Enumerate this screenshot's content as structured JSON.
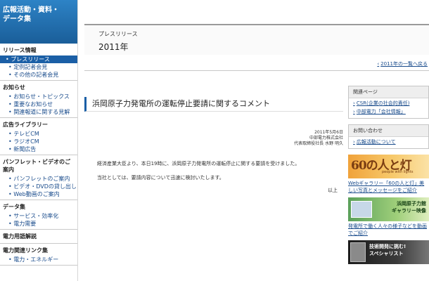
{
  "sidebar": {
    "header_line1": "広報活動・資料・",
    "header_line2": "データ集",
    "sections": [
      {
        "title": "リリース情報",
        "items": [
          "プレスリリース",
          "定例記者会見",
          "その他の記者会見"
        ]
      },
      {
        "title": "お知らせ",
        "items": [
          "お知らせ・トピックス",
          "重要なお知らせ",
          "関連報道に関する見解"
        ]
      },
      {
        "title": "広告ライブラリー",
        "items": [
          "テレビCM",
          "ラジオCM",
          "新聞広告"
        ]
      },
      {
        "title": "パンフレット・ビデオのご案内",
        "items": [
          "パンフレットのご案内",
          "ビデオ・DVDの貸し出し",
          "Web動画のご案内"
        ]
      },
      {
        "title": "データ集",
        "items": [
          "サービス・効率化",
          "電力需要"
        ]
      },
      {
        "title": "電力用語解説",
        "items": []
      },
      {
        "title": "電力関連リンク集",
        "items": [
          "電力・エネルギー"
        ]
      }
    ],
    "active_item": "プレスリリース"
  },
  "main": {
    "press_label": "プレスリリース",
    "year_title": "2011年",
    "back_link": "2011年の一覧へ戻る",
    "article": {
      "title": "浜岡原子力発電所の運転停止要請に関するコメント",
      "date": "2011年5月6日",
      "company": "中部電力株式会社",
      "signer": "代表取締役社長 水野 明久",
      "paragraph1": "経済産業大臣より、本日19時に、浜岡原子力発電所の運転停止に関する要請を受けました。",
      "paragraph2": "当社としては、要請内容について迅速に検討いたします。",
      "closing": "以上"
    }
  },
  "right": {
    "related_head": "関連ページ",
    "related_links": [
      "CSR(企業の社会的責任)",
      "中部電力「会社情報」"
    ],
    "contact_head": "お問い合わせ",
    "contact_link": "広報活動について",
    "banner1_big": "60の人と灯",
    "banner1_sub": "people with lights",
    "banner1_caption": "Webギャラリー「60の人と灯」美しい写真とメッセージをご紹介",
    "banner2_text_line1": "浜岡原子力館",
    "banner2_text_line2": "ギャラリー映像",
    "banner2_caption": "発電所で働く人々の様子などを動画でご紹介",
    "banner3_text_line1": "技術開発に挑む!",
    "banner3_text_line2": "スペシャリスト"
  },
  "colors": {
    "accent": "#1b5fa6",
    "link": "#1a4c8c",
    "sidebar_header": "#1a5e99"
  }
}
